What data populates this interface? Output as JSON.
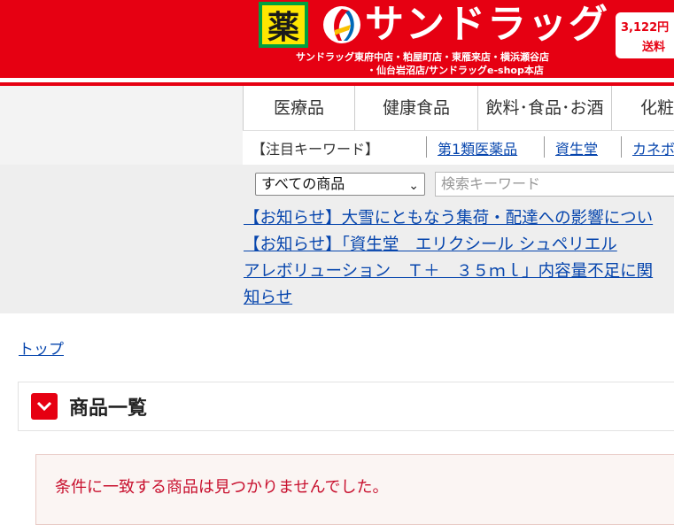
{
  "header": {
    "kusuri_char": "薬",
    "logo_text": "サンドラッグ",
    "stores_line1": "サンドラッグ東府中店・粕屋町店・東雁来店・横浜瀬谷店",
    "stores_line2": "・仙台岩沼店/サンドラッグe-shop本店",
    "promo_price": "3,122円",
    "promo_label": "送料",
    "brand_color": "#e60012"
  },
  "nav": {
    "items": [
      {
        "label": "医療品"
      },
      {
        "label": "健康食品"
      },
      {
        "label": "飲料･食品･お酒"
      },
      {
        "label": "化粧"
      }
    ]
  },
  "keywords": {
    "label": "【注目キーワード】",
    "links": [
      "第1類医薬品",
      "資生堂",
      "カネボ"
    ]
  },
  "search": {
    "category_selected": "すべての商品",
    "placeholder": "検索キーワード"
  },
  "notices": [
    "【お知らせ】大雪にともなう集荷・配達への影響につい",
    "【お知らせ】「資生堂　エリクシール シュペリエル",
    "アレボリューション　Ｔ＋　３５ｍｌ」内容量不足に関",
    "知らせ"
  ],
  "breadcrumb": {
    "top": "トップ"
  },
  "page": {
    "title": "商品一覧",
    "empty_message": "条件に一致する商品は見つかりませんでした。"
  }
}
